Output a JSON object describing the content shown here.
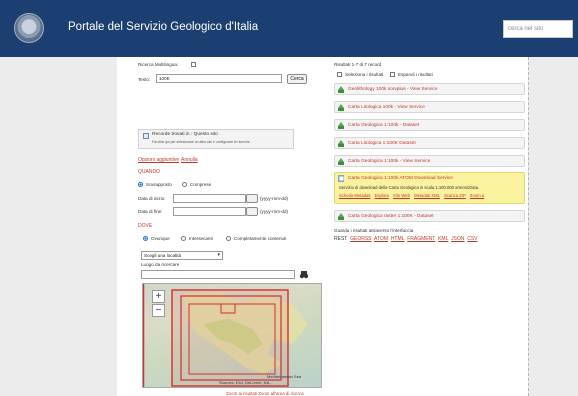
{
  "header": {
    "title": "Portale del Servizio Geologico d'Italia",
    "search_placeholder": "cerca nel sito"
  },
  "form": {
    "multilingual_label": "Ricerca Multilingua:",
    "text_label": "Testo:",
    "text_value": "100K",
    "search_button": "Cerca",
    "records_title": "Recorde trovati in : Questo sito",
    "records_sub": "Fai click qui per selezionare un altro sito e configurare le ricerche.",
    "optional_options": "Opzioni aggiuntive",
    "cancel": "Annulla",
    "when_label": "QUANDO",
    "overlap": "Sovrapposto",
    "comprise": "Comprese",
    "date_from_label": "Data di inizio:",
    "date_to_label": "Data di fine:",
    "date_format": "(yyyy-mm-dd)",
    "where_label": "DOVE",
    "anywhere": "Ovunque",
    "intersect": "Intersecanti",
    "contained": "Completamente contenuti",
    "place_select": "Scegli una località",
    "place_search_label": "Luogo da ricercare"
  },
  "map": {
    "attribution": "Sources: Esri, DeLorme, NA...",
    "sea_label": "Mediterranean Sea",
    "zoom_in": "+",
    "zoom_out": "−"
  },
  "map_footer": "Zoom ai risultati  Zoom all'area di ricerca",
  "results": {
    "count_text": "Risultati 1-7 di 7 record",
    "select_label": "Seleziona i risultati",
    "expand_label": "Espandi i risultati",
    "items": [
      {
        "label": "Geolithology 100k sorvplus - View Service"
      },
      {
        "label": "Carta Litologica 100k - View Service"
      },
      {
        "label": "Carta Geologica 1:100k - Dataset"
      },
      {
        "label": "Carta Litologica 1:100K Dataset"
      },
      {
        "label": "Carta Geologica 1:100k - View Service"
      },
      {
        "label": "Carta Geologica 1:100k ATOM Download Service"
      },
      {
        "label": "Carta Geologica raster 1:100K - Dataset"
      }
    ],
    "highlight_desc": "Servizio di download della Carta Geologica in scala 1:100.000 armonizzata.",
    "sub_links": [
      "Scheda Metadati",
      "Esplora",
      "Sito Web",
      "Metadati XML",
      "Scarica ZIP",
      "Zoom a"
    ],
    "view_via_label": "Guarda i risultati attraverso l'interfaccia",
    "formats": [
      "REST",
      "GEORSS",
      "ATOM",
      "HTML",
      "FRAGMENT",
      "KML",
      "JSON",
      "CSV"
    ]
  },
  "colors": {
    "header_bg": "#1b3f70",
    "link_red": "#c0392b",
    "highlight": "#fbf2a0"
  }
}
